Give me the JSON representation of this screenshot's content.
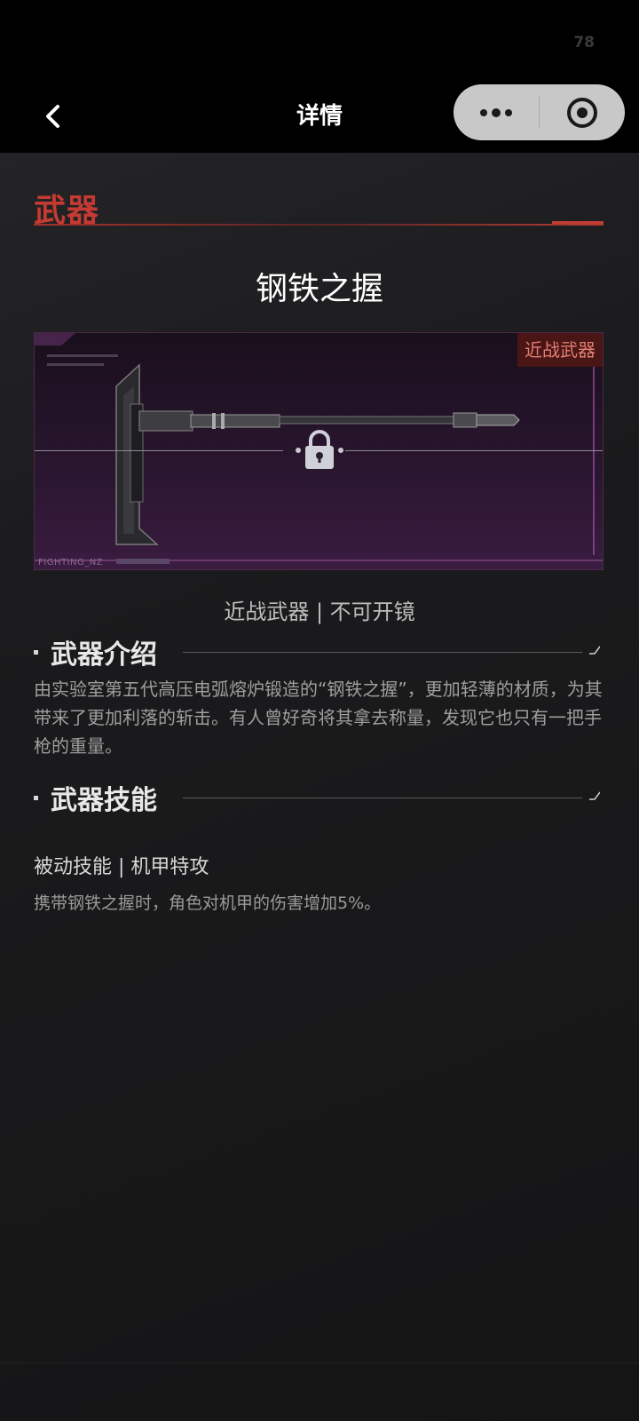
{
  "status": {
    "number": "78"
  },
  "nav": {
    "title": "详情"
  },
  "section": {
    "title": "武器"
  },
  "weapon": {
    "name": "钢铁之握",
    "tag": "近战武器",
    "card_footer": "FIGHTING_NZ",
    "sub_info": "近战武器 | 不可开镜"
  },
  "intro": {
    "heading": "武器介绍",
    "text": "由实验室第五代高压电弧熔炉锻造的“钢铁之握”，更加轻薄的材质，为其带来了更加利落的斩击。有人曾好奇将其拿去称量，发现它也只有一把手枪的重量。"
  },
  "skill": {
    "heading": "武器技能",
    "title": "被动技能 | 机甲特攻",
    "desc": "携带钢铁之握时，角色对机甲的伤害增加5%。"
  },
  "icons": {
    "back": "chevron-left-icon",
    "more": "more-dots-icon",
    "target": "target-icon",
    "lock": "lock-icon"
  },
  "colors": {
    "accent": "#c53a32",
    "background": "#19191b"
  }
}
